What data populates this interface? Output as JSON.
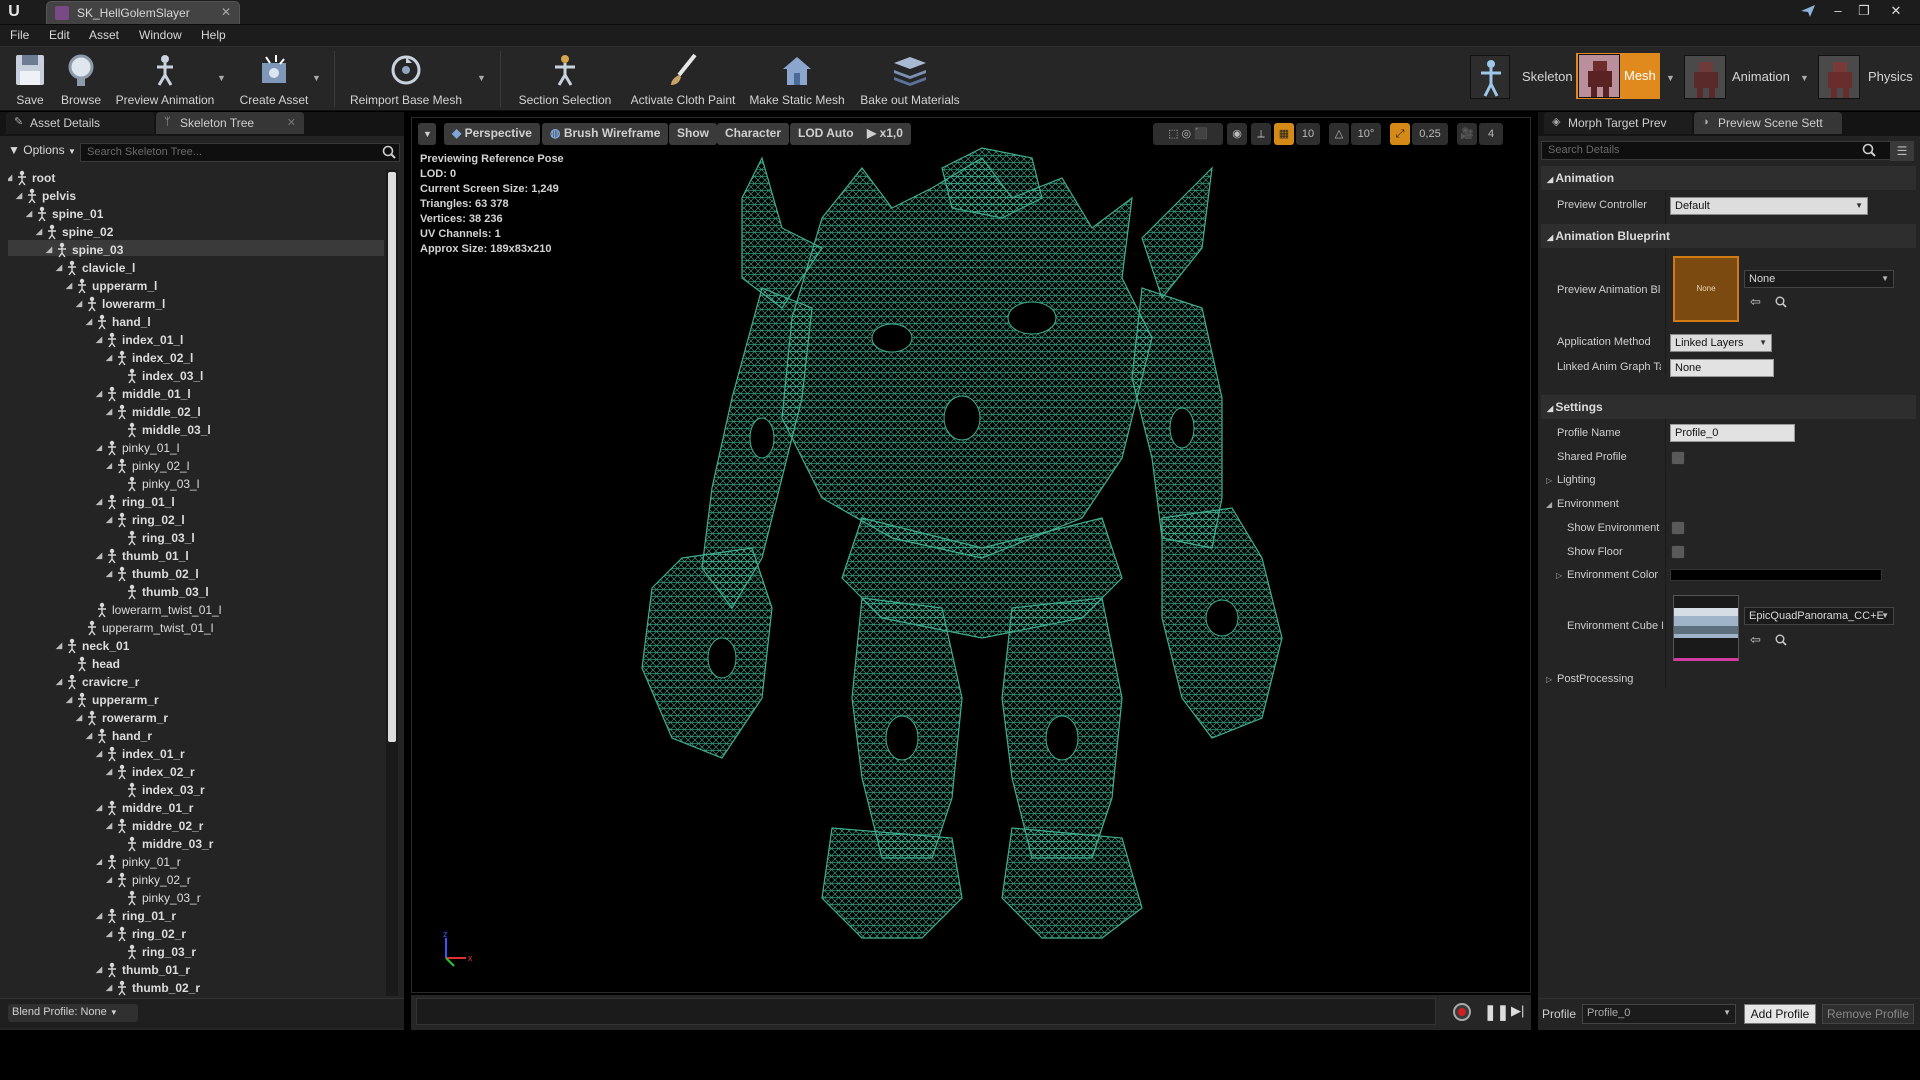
{
  "window": {
    "title": "SK_HellGolemSlayer",
    "minimize": "–",
    "maximize": "❐",
    "close": "✕"
  },
  "menu": [
    "File",
    "Edit",
    "Asset",
    "Window",
    "Help"
  ],
  "toolbar": {
    "save": "Save",
    "browse": "Browse",
    "preview_animation": "Preview Animation",
    "create_asset": "Create Asset",
    "reimport_base_mesh": "Reimport Base Mesh",
    "section_selection": "Section Selection",
    "activate_cloth_paint": "Activate Cloth Paint",
    "make_static_mesh": "Make Static Mesh",
    "bake_out_materials": "Bake out Materials"
  },
  "modes": {
    "skeleton": "Skeleton",
    "mesh": "Mesh",
    "animation": "Animation",
    "physics": "Physics",
    "active": "Mesh"
  },
  "left_panel": {
    "tabs": [
      "Asset Details",
      "Skeleton Tree"
    ],
    "active_tab": "Skeleton Tree",
    "options_label": "Options",
    "search_placeholder": "Search Skeleton Tree...",
    "selected_bone": "spine_03",
    "bones": [
      {
        "name": "root",
        "depth": 0,
        "bold": true,
        "expander": "◢"
      },
      {
        "name": "pelvis",
        "depth": 1,
        "bold": true,
        "expander": "◢"
      },
      {
        "name": "spine_01",
        "depth": 2,
        "bold": true,
        "expander": "◢"
      },
      {
        "name": "spine_02",
        "depth": 3,
        "bold": true,
        "expander": "◢"
      },
      {
        "name": "spine_03",
        "depth": 4,
        "bold": true,
        "expander": "◢"
      },
      {
        "name": "clavicle_l",
        "depth": 5,
        "bold": true,
        "expander": "◢"
      },
      {
        "name": "upperarm_l",
        "depth": 6,
        "bold": true,
        "expander": "◢"
      },
      {
        "name": "lowerarm_l",
        "depth": 7,
        "bold": true,
        "expander": "◢"
      },
      {
        "name": "hand_l",
        "depth": 8,
        "bold": true,
        "expander": "◢"
      },
      {
        "name": "index_01_l",
        "depth": 9,
        "bold": true,
        "expander": "◢"
      },
      {
        "name": "index_02_l",
        "depth": 10,
        "bold": true,
        "expander": "◢"
      },
      {
        "name": "index_03_l",
        "depth": 11,
        "bold": true,
        "expander": ""
      },
      {
        "name": "middle_01_l",
        "depth": 9,
        "bold": true,
        "expander": "◢"
      },
      {
        "name": "middle_02_l",
        "depth": 10,
        "bold": true,
        "expander": "◢"
      },
      {
        "name": "middle_03_l",
        "depth": 11,
        "bold": true,
        "expander": ""
      },
      {
        "name": "pinky_01_l",
        "depth": 9,
        "bold": false,
        "expander": "◢"
      },
      {
        "name": "pinky_02_l",
        "depth": 10,
        "bold": false,
        "expander": "◢"
      },
      {
        "name": "pinky_03_l",
        "depth": 11,
        "bold": false,
        "expander": ""
      },
      {
        "name": "ring_01_l",
        "depth": 9,
        "bold": true,
        "expander": "◢"
      },
      {
        "name": "ring_02_l",
        "depth": 10,
        "bold": true,
        "expander": "◢"
      },
      {
        "name": "ring_03_l",
        "depth": 11,
        "bold": true,
        "expander": ""
      },
      {
        "name": "thumb_01_l",
        "depth": 9,
        "bold": true,
        "expander": "◢"
      },
      {
        "name": "thumb_02_l",
        "depth": 10,
        "bold": true,
        "expander": "◢"
      },
      {
        "name": "thumb_03_l",
        "depth": 11,
        "bold": true,
        "expander": ""
      },
      {
        "name": "lowerarm_twist_01_l",
        "depth": 8,
        "bold": false,
        "expander": ""
      },
      {
        "name": "upperarm_twist_01_l",
        "depth": 7,
        "bold": false,
        "expander": ""
      },
      {
        "name": "neck_01",
        "depth": 5,
        "bold": true,
        "expander": "◢"
      },
      {
        "name": "head",
        "depth": 6,
        "bold": true,
        "expander": ""
      },
      {
        "name": "cravicre_r",
        "depth": 5,
        "bold": true,
        "expander": "◢"
      },
      {
        "name": "upperarm_r",
        "depth": 6,
        "bold": true,
        "expander": "◢"
      },
      {
        "name": "rowerarm_r",
        "depth": 7,
        "bold": true,
        "expander": "◢"
      },
      {
        "name": "hand_r",
        "depth": 8,
        "bold": true,
        "expander": "◢"
      },
      {
        "name": "index_01_r",
        "depth": 9,
        "bold": true,
        "expander": "◢"
      },
      {
        "name": "index_02_r",
        "depth": 10,
        "bold": true,
        "expander": "◢"
      },
      {
        "name": "index_03_r",
        "depth": 11,
        "bold": true,
        "expander": ""
      },
      {
        "name": "middre_01_r",
        "depth": 9,
        "bold": true,
        "expander": "◢"
      },
      {
        "name": "middre_02_r",
        "depth": 10,
        "bold": true,
        "expander": "◢"
      },
      {
        "name": "middre_03_r",
        "depth": 11,
        "bold": true,
        "expander": ""
      },
      {
        "name": "pinky_01_r",
        "depth": 9,
        "bold": false,
        "expander": "◢"
      },
      {
        "name": "pinky_02_r",
        "depth": 10,
        "bold": false,
        "expander": "◢"
      },
      {
        "name": "pinky_03_r",
        "depth": 11,
        "bold": false,
        "expander": ""
      },
      {
        "name": "ring_01_r",
        "depth": 9,
        "bold": true,
        "expander": "◢"
      },
      {
        "name": "ring_02_r",
        "depth": 10,
        "bold": true,
        "expander": "◢"
      },
      {
        "name": "ring_03_r",
        "depth": 11,
        "bold": true,
        "expander": ""
      },
      {
        "name": "thumb_01_r",
        "depth": 9,
        "bold": true,
        "expander": "◢"
      },
      {
        "name": "thumb_02_r",
        "depth": 10,
        "bold": true,
        "expander": "◢"
      }
    ],
    "blend_profile": "Blend Profile: None"
  },
  "viewport": {
    "buttons": {
      "perspective": "Perspective",
      "brush_wireframe": "Brush Wireframe",
      "show": "Show",
      "character": "Character",
      "lod": "LOD Auto",
      "play_speed": "x1,0"
    },
    "right_controls": {
      "grid_snap": "10",
      "rot_snap": "10°",
      "scale_snap": "0,25",
      "cam_speed": "4"
    },
    "stats": [
      "Previewing Reference Pose",
      "LOD: 0",
      "Current Screen Size: 1,249",
      "Triangles: 63 378",
      "Vertices: 38 236",
      "UV Channels: 1",
      "Approx Size: 189x83x210"
    ],
    "axis_x": "x",
    "axis_z": "z",
    "wire_color": "#3fae8e"
  },
  "right_panel": {
    "tabs": [
      "Morph Target Prev",
      "Preview Scene Sett"
    ],
    "active_tab": "Preview Scene Sett",
    "search_placeholder": "Search Details",
    "sections": {
      "animation": "Animation",
      "animation_blueprint": "Animation Blueprint",
      "settings": "Settings"
    },
    "props": {
      "preview_controller_label": "Preview Controller",
      "preview_controller_value": "Default",
      "preview_anim_bp_label": "Preview Animation Bl",
      "anim_bp_thumb_text": "None",
      "anim_bp_value": "None",
      "application_method_label": "Application Method",
      "application_method_value": "Linked Layers",
      "linked_anim_graph_label": "Linked Anim Graph Ta",
      "linked_anim_graph_value": "None",
      "profile_name_label": "Profile Name",
      "profile_name_value": "Profile_0",
      "shared_profile_label": "Shared Profile",
      "lighting_label": "Lighting",
      "environment_label": "Environment",
      "show_environment_label": "Show Environment",
      "show_floor_label": "Show Floor",
      "environment_color_label": "Environment Color",
      "environment_cube_label": "Environment Cube M",
      "environment_cube_value": "EpicQuadPanorama_CC+E",
      "postprocessing_label": "PostProcessing"
    },
    "footer": {
      "profile_label": "Profile",
      "profile_value": "Profile_0",
      "add_profile": "Add Profile",
      "remove_profile": "Remove Profile"
    }
  },
  "colors": {
    "mesh_mode_active": "#e08a1e",
    "accent_orange": "#c97a12"
  }
}
